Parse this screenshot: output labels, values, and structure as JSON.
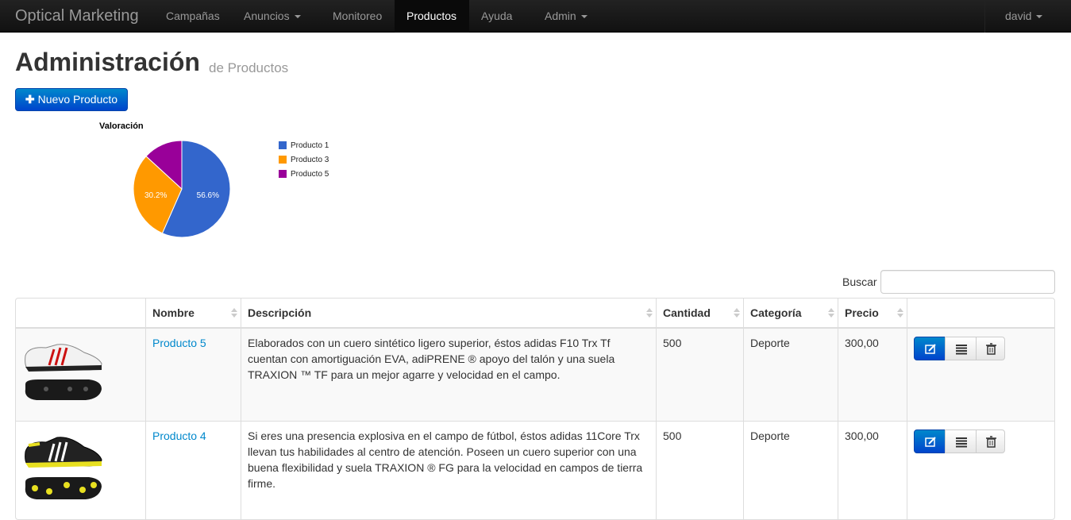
{
  "navbar": {
    "brand": "Optical Marketing",
    "items": [
      {
        "label": "Campañas",
        "caret": false,
        "active": false
      },
      {
        "label": "Anuncios",
        "caret": true,
        "active": false
      },
      {
        "label": "Monitoreo",
        "caret": false,
        "active": false
      },
      {
        "label": "Productos",
        "caret": false,
        "active": true
      },
      {
        "label": "Ayuda",
        "caret": false,
        "active": false
      },
      {
        "label": "Admin",
        "caret": true,
        "active": false
      }
    ],
    "user": "david"
  },
  "header": {
    "title": "Administración",
    "subtitle": "de Productos",
    "new_button": "Nuevo Producto",
    "new_button_icon": "plus-icon"
  },
  "chart_data": {
    "type": "pie",
    "title": "Valoración",
    "slices": [
      {
        "label": "Producto 1",
        "value": 56.6,
        "color": "#3366cc",
        "display": "56.6%"
      },
      {
        "label": "Producto 3",
        "value": 30.2,
        "color": "#ff9900",
        "display": "30.2%"
      },
      {
        "label": "Producto 5",
        "value": 13.2,
        "color": "#990099",
        "display": ""
      }
    ],
    "legend_position": "right"
  },
  "search": {
    "label": "Buscar",
    "value": ""
  },
  "table": {
    "columns": [
      "",
      "Nombre",
      "Descripción",
      "Cantidad",
      "Categoría",
      "Precio",
      ""
    ],
    "rows": [
      {
        "name": "Producto 5",
        "description": "Elaborados con un cuero sintético ligero superior, éstos adidas F10 Trx Tf cuentan con amortiguación EVA, adiPRENE ® apoyo del talón y una suela TRAXION ™ TF para un mejor agarre y velocidad en el campo.",
        "quantity": "500",
        "category": "Deporte",
        "price": "300,00",
        "image": "shoe-white-red"
      },
      {
        "name": "Producto 4",
        "description": "Si eres una presencia explosiva en el campo de fútbol, éstos adidas 11Core Trx llevan tus habilidades al centro de atención. Poseen un cuero superior con una buena flexibilidad y suela TRAXION ® FG para la velocidad en campos de tierra firme.",
        "quantity": "500",
        "category": "Deporte",
        "price": "300,00",
        "image": "shoe-black-yellow"
      }
    ],
    "actions": [
      "edit-icon",
      "list-icon",
      "trash-icon"
    ]
  },
  "colors": {
    "navbar_bg": "#1b1b1b",
    "primary": "#0055cc",
    "link": "#0088cc"
  }
}
